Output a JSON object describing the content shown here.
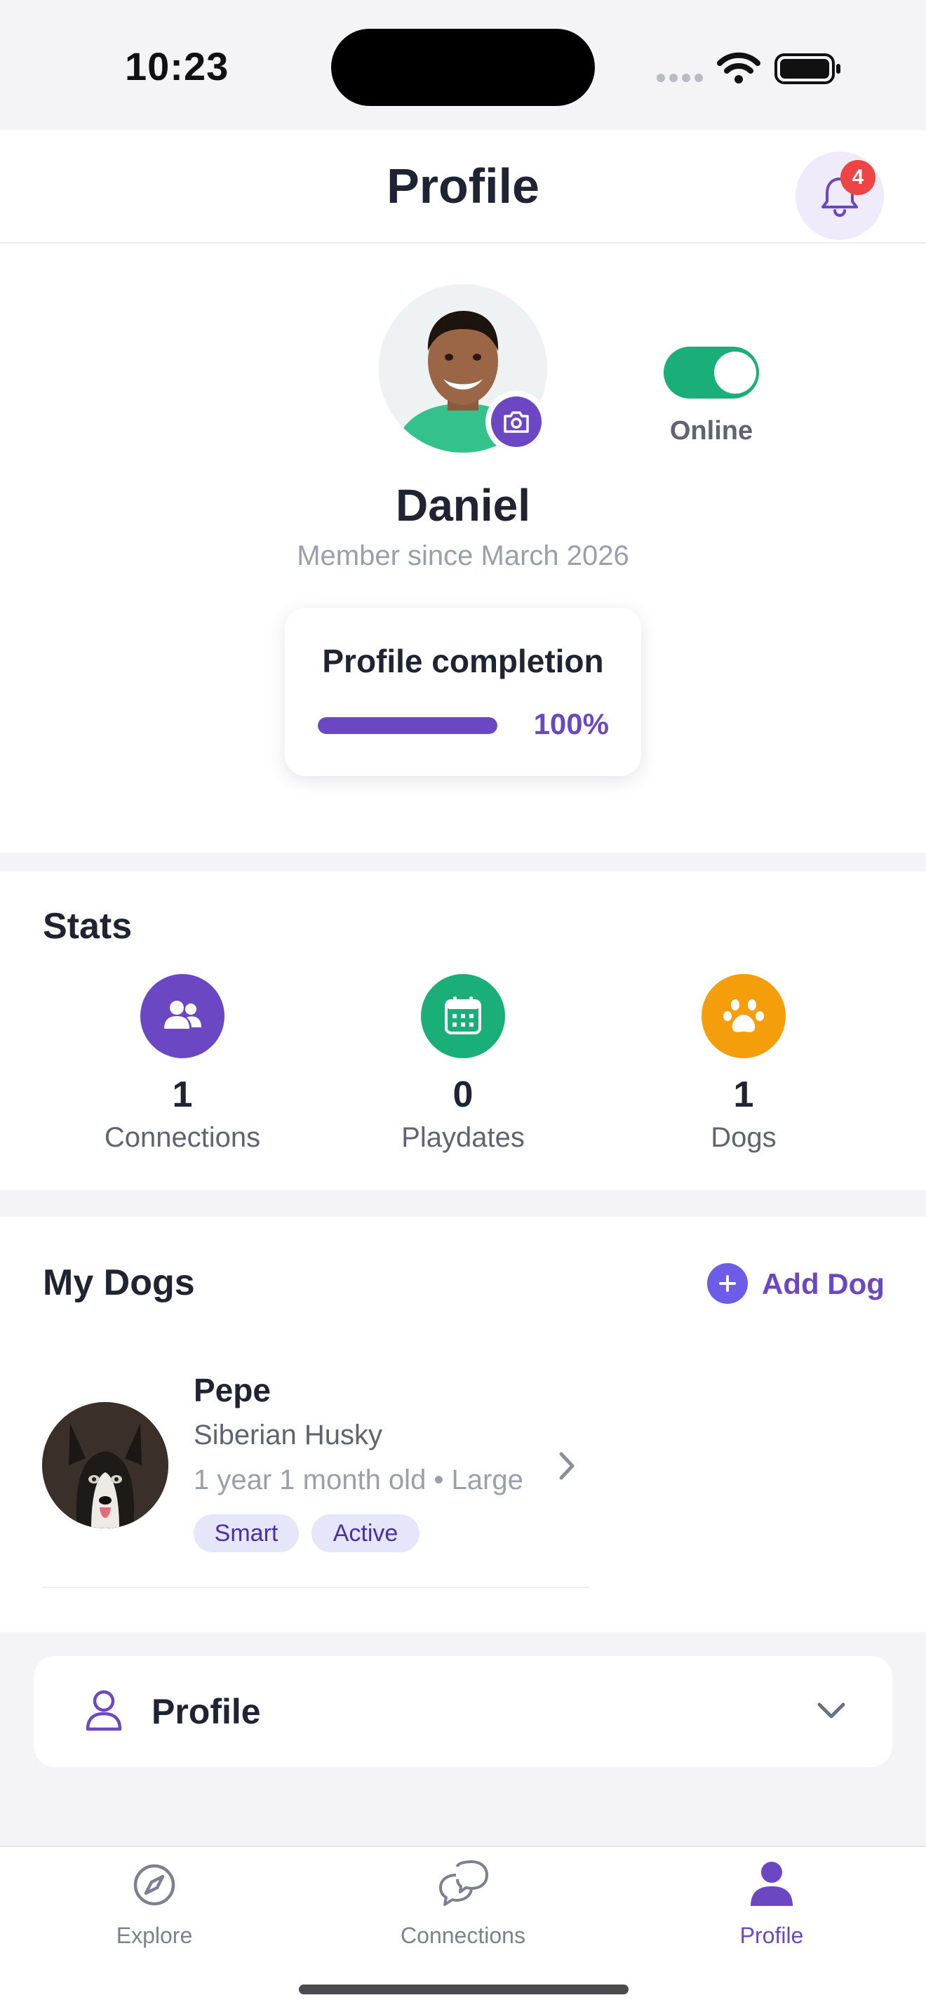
{
  "status_bar": {
    "time": "10:23"
  },
  "header": {
    "title": "Profile",
    "notification_count": "4"
  },
  "profile": {
    "name": "Daniel",
    "member_since": "Member since March 2026",
    "online_label": "Online",
    "online": true,
    "completion_title": "Profile completion",
    "completion_percent": 100,
    "completion_text": "100%"
  },
  "stats": {
    "title": "Stats",
    "items": [
      {
        "value": "1",
        "label": "Connections",
        "icon": "people-icon",
        "color": "#6c47c4"
      },
      {
        "value": "0",
        "label": "Playdates",
        "icon": "calendar-icon",
        "color": "#1aae78"
      },
      {
        "value": "1",
        "label": "Dogs",
        "icon": "paw-icon",
        "color": "#f59e0b"
      }
    ]
  },
  "dogs": {
    "title": "My Dogs",
    "add_label": "Add Dog",
    "items": [
      {
        "name": "Pepe",
        "breed": "Siberian Husky",
        "meta": "1 year 1 month old • Large",
        "tags": [
          "Smart",
          "Active"
        ]
      }
    ]
  },
  "accordion": {
    "label": "Profile"
  },
  "tabbar": {
    "items": [
      {
        "label": "Explore",
        "icon": "compass-icon",
        "active": false
      },
      {
        "label": "Connections",
        "icon": "chat-bubbles-icon",
        "active": false
      },
      {
        "label": "Profile",
        "icon": "person-icon",
        "active": true
      }
    ]
  },
  "colors": {
    "accent": "#6c47c4",
    "online": "#1aae78",
    "badge": "#ef4444"
  }
}
